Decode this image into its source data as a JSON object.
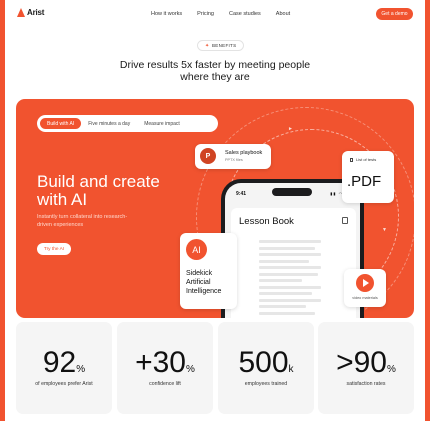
{
  "nav": {
    "logo": "Arist",
    "links": [
      "How it works",
      "Pricing",
      "Case studies",
      "About"
    ],
    "cta": "Get a demo"
  },
  "header": {
    "badge": "BENEFITS",
    "headline": "Drive results 5x faster by meeting people where they are"
  },
  "hero": {
    "tabs": [
      "Build with AI",
      "Five minutes a day",
      "Measure impact"
    ],
    "active_tab": "Build with AI",
    "title": "Build and create with AI",
    "subtitle": "Instantly turn collateral into research-driven experiences",
    "button": "Try the AI",
    "phone": {
      "time": "9:41",
      "doc_title": "Lesson Book"
    },
    "cards": {
      "sales_title": "Sales playbook",
      "sales_sub": "PPTX files",
      "pdf_list": "List of tests",
      "pdf_big": ".PDF",
      "ai_badge": "AI",
      "ai_text": "Sidekick Artificial Intelligence",
      "video_label": "video materials"
    }
  },
  "stats": [
    {
      "prefix": "",
      "value": "92",
      "unit": "%",
      "label": "of employees prefer Arist"
    },
    {
      "prefix": "+",
      "value": "30",
      "unit": "%",
      "label": "confidence lift"
    },
    {
      "prefix": "",
      "value": "500",
      "unit": "k",
      "label": "employees trained"
    },
    {
      "prefix": ">",
      "value": "90",
      "unit": "%",
      "label": "satisfaction rates"
    }
  ],
  "colors": {
    "accent": "#f1532f",
    "stat_bg": "#f5f5f5"
  }
}
